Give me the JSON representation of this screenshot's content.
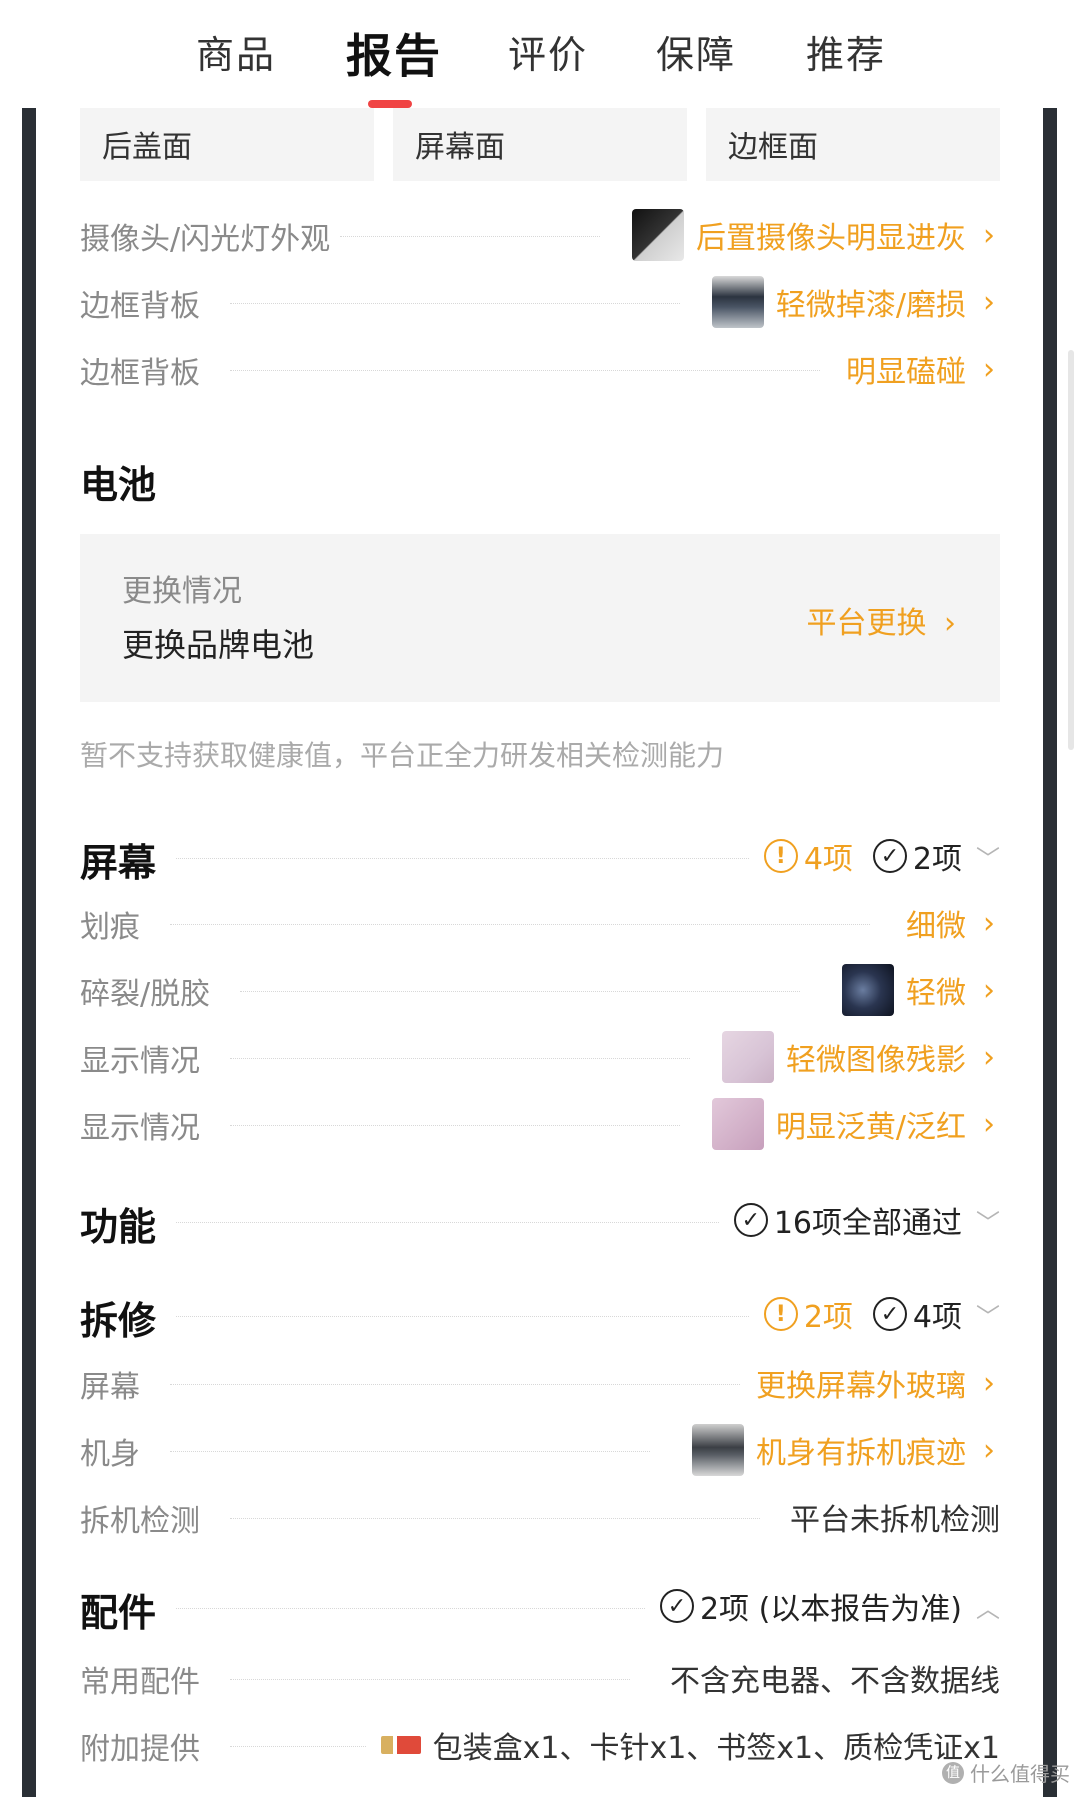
{
  "tabs": [
    "商品",
    "报告",
    "评价",
    "保障",
    "推荐"
  ],
  "subtabs": [
    "后盖面",
    "屏幕面",
    "边框面"
  ],
  "appearance_rows": [
    {
      "label": "摄像头/闪光灯外观",
      "value": "后置摄像头明显进灰"
    },
    {
      "label": "边框背板",
      "value": "轻微掉漆/磨损"
    },
    {
      "label": "边框背板",
      "value": "明显磕碰"
    }
  ],
  "battery": {
    "title": "电池",
    "sub": "更换情况",
    "main": "更换品牌电池",
    "link": "平台更换",
    "note": "暂不支持获取健康值，平台正全力研发相关检测能力"
  },
  "screen": {
    "title": "屏幕",
    "warn_count": "4项",
    "ok_count": "2项",
    "rows": [
      {
        "label": "划痕",
        "value": "细微"
      },
      {
        "label": "碎裂/脱胶",
        "value": "轻微"
      },
      {
        "label": "显示情况",
        "value": "轻微图像残影"
      },
      {
        "label": "显示情况",
        "value": "明显泛黄/泛红"
      }
    ]
  },
  "function": {
    "title": "功能",
    "ok_text": "16项全部通过"
  },
  "repair": {
    "title": "拆修",
    "warn_count": "2项",
    "ok_count": "4项",
    "rows": [
      {
        "label": "屏幕",
        "value": "更换屏幕外玻璃"
      },
      {
        "label": "机身",
        "value": "机身有拆机痕迹"
      },
      {
        "label": "拆机检测",
        "value": "平台未拆机检测"
      }
    ]
  },
  "accessories": {
    "title": "配件",
    "ok_text": "2项 (以本报告为准)",
    "rows": [
      {
        "label": "常用配件",
        "value": "不含充电器、不含数据线"
      },
      {
        "label": "附加提供",
        "value": "包装盒x1、卡针x1、书签x1、质检凭证x1"
      }
    ]
  },
  "watermark": "什么值得买",
  "icons": {
    "chevron": "chevron-right-icon",
    "warn": "exclamation-circle-icon",
    "ok": "check-circle-icon",
    "collapse": "chevron-down-icon",
    "expand": "chevron-up-icon"
  },
  "colors": {
    "accent": "#f0a020",
    "tab_indicator": "#f04444",
    "frame": "#2a2f35"
  }
}
